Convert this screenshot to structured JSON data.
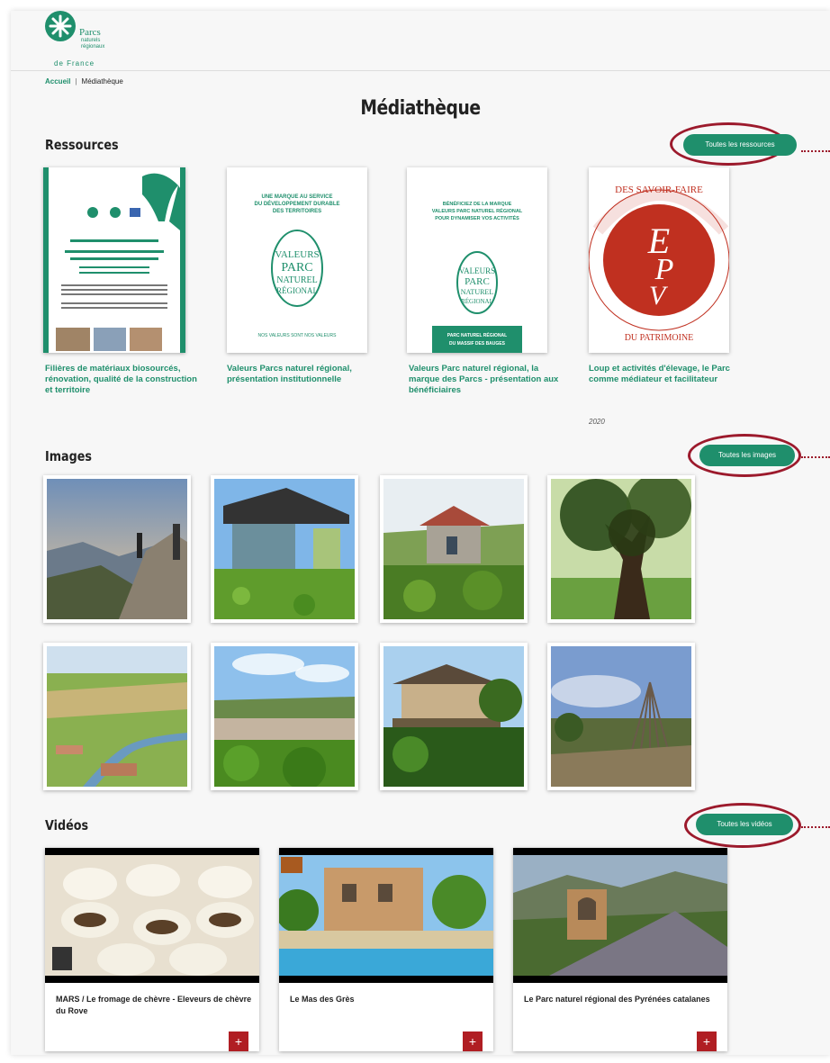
{
  "logo": {
    "name_line1": "Parcs",
    "name_line2": "naturels",
    "name_line3": "régionaux",
    "name_line4": "de France"
  },
  "breadcrumb": {
    "home": "Accueil",
    "separator": "|",
    "current": "Médiathèque"
  },
  "page_title": "Médiathèque",
  "resources": {
    "heading": "Ressources",
    "button": "Toutes les ressources",
    "items": [
      {
        "title": "Filières de matériaux biosourcés, rénovation, qualité de la construction et territoire"
      },
      {
        "title": "Valeurs Parcs naturel régional, présentation institutionnelle",
        "cover_text": "UNE MARQUE AU SERVICE DU DÉVELOPPEMENT DURABLE DES TERRITOIRES",
        "cover_footer": "NOS VALEURS SONT NOS VALEURS"
      },
      {
        "title": "Valeurs Parc naturel régional, la marque des Parcs - présentation aux bénéficiaires",
        "cover_text": "BÉNÉFICIEZ DE LA MARQUE VALEURS PARC NATUREL RÉGIONAL POUR DYNAMISER VOS ACTIVITÉS",
        "cover_footer": "PARC NATUREL RÉGIONAL DU MASSIF DES BAUGES"
      },
      {
        "title": "Loup et activités d'élevage, le Parc comme médiateur et facilitateur",
        "year": "2020",
        "cover_text": "EPV"
      }
    ]
  },
  "images": {
    "heading": "Images",
    "button": "Toutes les images",
    "count": 8
  },
  "videos": {
    "heading": "Vidéos",
    "button": "Toutes les vidéos",
    "items": [
      {
        "title": "MARS / Le fromage de chèvre - Eleveurs de chèvre du Rove",
        "plus": "+"
      },
      {
        "title": "Le Mas des Grès",
        "plus": "+"
      },
      {
        "title": "Le Parc naturel régional des Pyrénées catalanes",
        "plus": "+"
      }
    ]
  },
  "colors": {
    "accent": "#1f8f6c",
    "highlight": "#9c1a2c",
    "plus_button": "#b01e23"
  }
}
